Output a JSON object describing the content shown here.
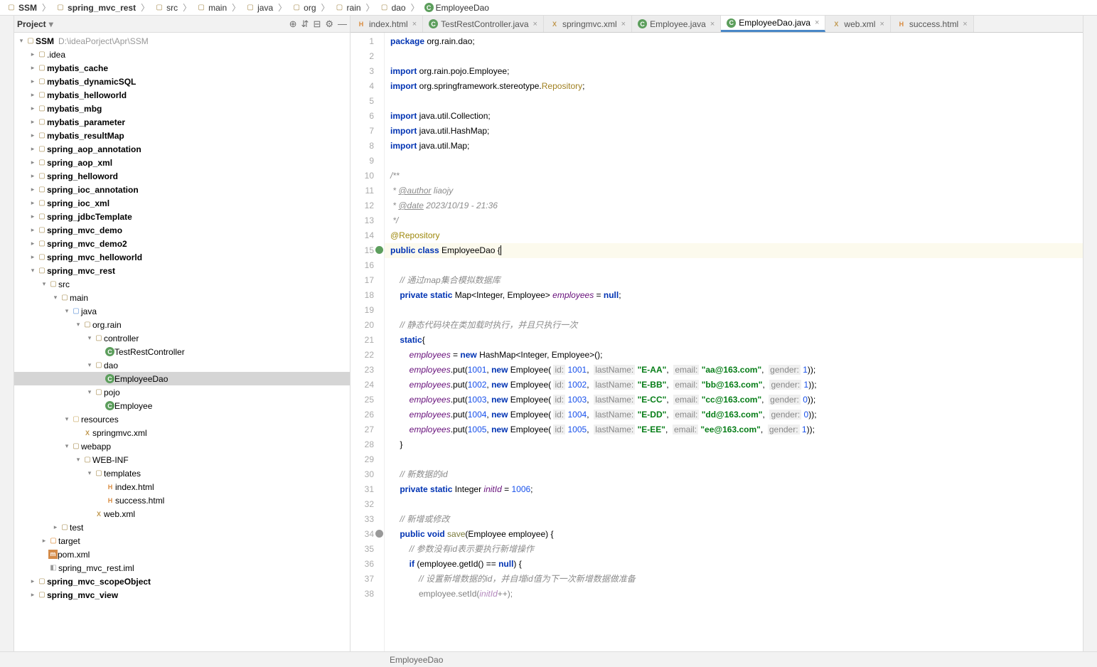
{
  "breadcrumb": [
    {
      "icon": "folder",
      "label": "SSM",
      "bold": true
    },
    {
      "icon": "folder",
      "label": "spring_mvc_rest",
      "bold": true
    },
    {
      "icon": "folder",
      "label": "src"
    },
    {
      "icon": "folder",
      "label": "main"
    },
    {
      "icon": "folder",
      "label": "java"
    },
    {
      "icon": "folder",
      "label": "org"
    },
    {
      "icon": "folder",
      "label": "rain"
    },
    {
      "icon": "folder",
      "label": "dao"
    },
    {
      "icon": "c",
      "label": "EmployeeDao"
    }
  ],
  "project_title": "Project",
  "project_root": {
    "label": "SSM",
    "path": "D:\\ideaPorject\\Apr\\SSM"
  },
  "tree": [
    {
      "d": 1,
      "a": ">",
      "i": "folder",
      "l": ".idea"
    },
    {
      "d": 1,
      "a": ">",
      "i": "folder",
      "l": "mybatis_cache",
      "b": true
    },
    {
      "d": 1,
      "a": ">",
      "i": "folder",
      "l": "mybatis_dynamicSQL",
      "b": true
    },
    {
      "d": 1,
      "a": ">",
      "i": "folder",
      "l": "mybatis_helloworld",
      "b": true
    },
    {
      "d": 1,
      "a": ">",
      "i": "folder",
      "l": "mybatis_mbg",
      "b": true
    },
    {
      "d": 1,
      "a": ">",
      "i": "folder",
      "l": "mybatis_parameter",
      "b": true
    },
    {
      "d": 1,
      "a": ">",
      "i": "folder",
      "l": "mybatis_resultMap",
      "b": true
    },
    {
      "d": 1,
      "a": ">",
      "i": "folder",
      "l": "spring_aop_annotation",
      "b": true
    },
    {
      "d": 1,
      "a": ">",
      "i": "folder",
      "l": "spring_aop_xml",
      "b": true
    },
    {
      "d": 1,
      "a": ">",
      "i": "folder",
      "l": "spring_helloword",
      "b": true
    },
    {
      "d": 1,
      "a": ">",
      "i": "folder",
      "l": "spring_ioc_annotation",
      "b": true
    },
    {
      "d": 1,
      "a": ">",
      "i": "folder",
      "l": "spring_ioc_xml",
      "b": true
    },
    {
      "d": 1,
      "a": ">",
      "i": "folder",
      "l": "spring_jdbcTemplate",
      "b": true
    },
    {
      "d": 1,
      "a": ">",
      "i": "folder",
      "l": "spring_mvc_demo",
      "b": true
    },
    {
      "d": 1,
      "a": ">",
      "i": "folder",
      "l": "spring_mvc_demo2",
      "b": true
    },
    {
      "d": 1,
      "a": ">",
      "i": "folder",
      "l": "spring_mvc_helloworld",
      "b": true
    },
    {
      "d": 1,
      "a": "v",
      "i": "folder",
      "l": "spring_mvc_rest",
      "b": true
    },
    {
      "d": 2,
      "a": "v",
      "i": "folder",
      "l": "src"
    },
    {
      "d": 3,
      "a": "v",
      "i": "folder",
      "l": "main"
    },
    {
      "d": 4,
      "a": "v",
      "i": "folder-src",
      "l": "java"
    },
    {
      "d": 5,
      "a": "v",
      "i": "folder",
      "l": "org.rain"
    },
    {
      "d": 6,
      "a": "v",
      "i": "folder",
      "l": "controller"
    },
    {
      "d": 7,
      "a": "",
      "i": "c",
      "l": "TestRestController"
    },
    {
      "d": 6,
      "a": "v",
      "i": "folder",
      "l": "dao"
    },
    {
      "d": 7,
      "a": "",
      "i": "c",
      "l": "EmployeeDao",
      "sel": true
    },
    {
      "d": 6,
      "a": "v",
      "i": "folder",
      "l": "pojo"
    },
    {
      "d": 7,
      "a": "",
      "i": "c",
      "l": "Employee"
    },
    {
      "d": 4,
      "a": "v",
      "i": "folder-res",
      "l": "resources"
    },
    {
      "d": 5,
      "a": "",
      "i": "xml",
      "l": "springmvc.xml"
    },
    {
      "d": 4,
      "a": "v",
      "i": "folder",
      "l": "webapp"
    },
    {
      "d": 5,
      "a": "v",
      "i": "folder",
      "l": "WEB-INF"
    },
    {
      "d": 6,
      "a": "v",
      "i": "folder",
      "l": "templates"
    },
    {
      "d": 7,
      "a": "",
      "i": "html",
      "l": "index.html"
    },
    {
      "d": 7,
      "a": "",
      "i": "html",
      "l": "success.html"
    },
    {
      "d": 6,
      "a": "",
      "i": "xml",
      "l": "web.xml"
    },
    {
      "d": 3,
      "a": ">",
      "i": "folder",
      "l": "test"
    },
    {
      "d": 2,
      "a": ">",
      "i": "folder-ex",
      "l": "target"
    },
    {
      "d": 2,
      "a": "",
      "i": "m",
      "l": "pom.xml"
    },
    {
      "d": 2,
      "a": "",
      "i": "iml",
      "l": "spring_mvc_rest.iml"
    },
    {
      "d": 1,
      "a": ">",
      "i": "folder",
      "l": "spring_mvc_scopeObject",
      "b": true
    },
    {
      "d": 1,
      "a": ">",
      "i": "folder",
      "l": "spring_mvc_view",
      "b": true
    }
  ],
  "tabs": [
    {
      "i": "html",
      "l": "index.html"
    },
    {
      "i": "c",
      "l": "TestRestController.java"
    },
    {
      "i": "xml",
      "l": "springmvc.xml"
    },
    {
      "i": "c",
      "l": "Employee.java"
    },
    {
      "i": "c",
      "l": "EmployeeDao.java",
      "active": true
    },
    {
      "i": "xml",
      "l": "web.xml"
    },
    {
      "i": "html",
      "l": "success.html"
    }
  ],
  "code": {
    "lines": [
      {
        "n": 1,
        "h": "<span class='kw'>package</span> org.rain.dao;"
      },
      {
        "n": 2,
        "h": ""
      },
      {
        "n": 3,
        "h": "<span class='kw'>import</span> org.rain.pojo.Employee;"
      },
      {
        "n": 4,
        "h": "<span class='kw'>import</span> org.springframework.stereotype.<span class='warn'>Repository</span>;"
      },
      {
        "n": 5,
        "h": ""
      },
      {
        "n": 6,
        "h": "<span class='kw'>import</span> java.util.Collection;"
      },
      {
        "n": 7,
        "h": "<span class='kw'>import</span> java.util.HashMap;"
      },
      {
        "n": 8,
        "h": "<span class='kw'>import</span> java.util.Map;"
      },
      {
        "n": 9,
        "h": ""
      },
      {
        "n": 10,
        "h": "<span class='doc'>/**</span>"
      },
      {
        "n": 11,
        "h": "<span class='doc'> * </span><span class='doctag'>@author</span><span class='doc'> liaojy</span>"
      },
      {
        "n": 12,
        "h": "<span class='doc'> * </span><span class='doctag'>@date</span><span class='doc'> 2023/10/19 - 21:36</span>"
      },
      {
        "n": 13,
        "h": "<span class='doc'> */</span>"
      },
      {
        "n": 14,
        "h": "<span class='ann'>@Repository</span>"
      },
      {
        "n": 15,
        "h": "<span class='kw'>public class</span> <span class='cls'>EmployeeDao</span> {<span class='cursor'></span>",
        "hl": true,
        "mark": "#5c9e5c"
      },
      {
        "n": 16,
        "h": ""
      },
      {
        "n": 17,
        "h": "    <span class='cmt'>// 通过map集合模拟数据库</span>"
      },
      {
        "n": 18,
        "h": "    <span class='kw'>private static</span> Map&lt;Integer, Employee&gt; <span class='fld'>employees</span> = <span class='kw'>null</span>;"
      },
      {
        "n": 19,
        "h": ""
      },
      {
        "n": 20,
        "h": "    <span class='cmt'>// 静态代码块在类加载时执行，并且只执行一次</span>"
      },
      {
        "n": 21,
        "h": "    <span class='kw'>static</span>{"
      },
      {
        "n": 22,
        "h": "        <span class='fld'>employees</span> = <span class='kw'>new</span> HashMap&lt;Integer, Employee&gt;();"
      },
      {
        "n": 23,
        "h": "        <span class='fld'>employees</span>.put(<span class='num'>1001</span>, <span class='kw'>new</span> Employee( <span class='param'>id:</span> <span class='num'>1001</span>,  <span class='param'>lastName:</span> <span class='str'>\"E-AA\"</span>,  <span class='param'>email:</span> <span class='str'>\"aa@163.com\"</span>,  <span class='param'>gender:</span> <span class='num'>1</span>));"
      },
      {
        "n": 24,
        "h": "        <span class='fld'>employees</span>.put(<span class='num'>1002</span>, <span class='kw'>new</span> Employee( <span class='param'>id:</span> <span class='num'>1002</span>,  <span class='param'>lastName:</span> <span class='str'>\"E-BB\"</span>,  <span class='param'>email:</span> <span class='str'>\"bb@163.com\"</span>,  <span class='param'>gender:</span> <span class='num'>1</span>));"
      },
      {
        "n": 25,
        "h": "        <span class='fld'>employees</span>.put(<span class='num'>1003</span>, <span class='kw'>new</span> Employee( <span class='param'>id:</span> <span class='num'>1003</span>,  <span class='param'>lastName:</span> <span class='str'>\"E-CC\"</span>,  <span class='param'>email:</span> <span class='str'>\"cc@163.com\"</span>,  <span class='param'>gender:</span> <span class='num'>0</span>));"
      },
      {
        "n": 26,
        "h": "        <span class='fld'>employees</span>.put(<span class='num'>1004</span>, <span class='kw'>new</span> Employee( <span class='param'>id:</span> <span class='num'>1004</span>,  <span class='param'>lastName:</span> <span class='str'>\"E-DD\"</span>,  <span class='param'>email:</span> <span class='str'>\"dd@163.com\"</span>,  <span class='param'>gender:</span> <span class='num'>0</span>));"
      },
      {
        "n": 27,
        "h": "        <span class='fld'>employees</span>.put(<span class='num'>1005</span>, <span class='kw'>new</span> Employee( <span class='param'>id:</span> <span class='num'>1005</span>,  <span class='param'>lastName:</span> <span class='str'>\"E-EE\"</span>,  <span class='param'>email:</span> <span class='str'>\"ee@163.com\"</span>,  <span class='param'>gender:</span> <span class='num'>1</span>));"
      },
      {
        "n": 28,
        "h": "    }"
      },
      {
        "n": 29,
        "h": ""
      },
      {
        "n": 30,
        "h": "    <span class='cmt'>// 新数据的id</span>"
      },
      {
        "n": 31,
        "h": "    <span class='kw'>private static</span> Integer <span class='fld'>initId</span> = <span class='num'>1006</span>;"
      },
      {
        "n": 32,
        "h": ""
      },
      {
        "n": 33,
        "h": "    <span class='cmt'>// 新增或修改</span>"
      },
      {
        "n": 34,
        "h": "    <span class='kw'>public void</span> <span class='mth'>save</span>(Employee employee) {",
        "mark": "#999"
      },
      {
        "n": 35,
        "h": "        <span class='cmt'>// 参数没有id表示要执行新增操作</span>"
      },
      {
        "n": 36,
        "h": "        <span class='kw'>if</span> (employee.getId() == <span class='kw'>null</span>) {"
      },
      {
        "n": 37,
        "h": "            <span class='cmt'>// 设置新增数据的id，并自增id值为下一次新增数据做准备</span>"
      },
      {
        "n": 38,
        "h": "            employee.setId(<span class='fld'>initId</span>++);",
        "fade": true
      }
    ]
  },
  "status": {
    "context": "EmployeeDao"
  }
}
